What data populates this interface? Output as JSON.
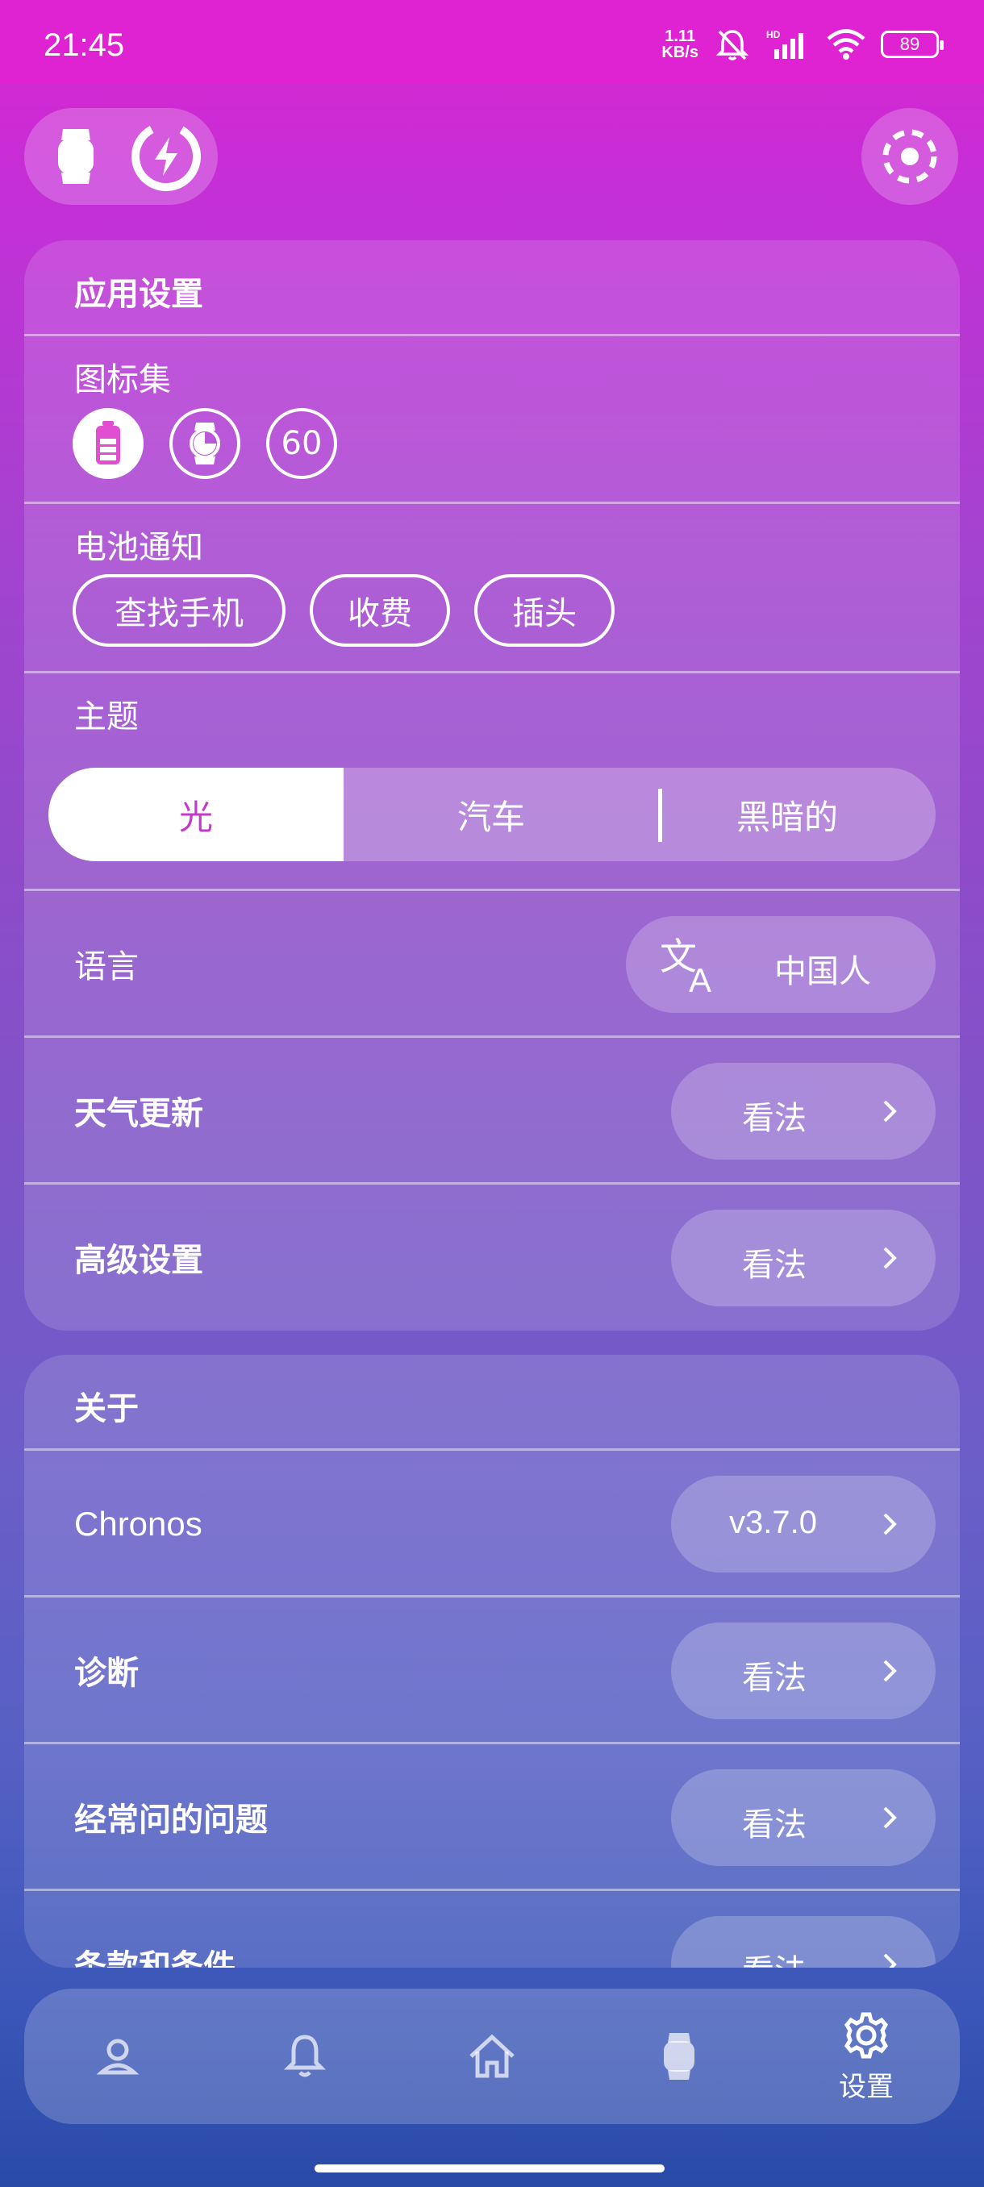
{
  "status_bar": {
    "time": "21:45",
    "net_speed_value": "1.11",
    "net_speed_unit": "KB/s",
    "battery_level": "89"
  },
  "top_bar": {
    "watch_icon": "watch-icon",
    "charge_icon": "charging-icon",
    "loader_icon": "loading-ring-icon"
  },
  "app_settings": {
    "title": "应用设置",
    "icon_set": {
      "label": "图标集",
      "options": [
        {
          "icon": "battery-icon",
          "selected": true
        },
        {
          "icon": "watch-face-icon",
          "selected": false
        },
        {
          "text": "60",
          "selected": false
        }
      ]
    },
    "battery_notifications": {
      "label": "电池通知",
      "chips": [
        "查找手机",
        "收费",
        "插头"
      ]
    },
    "theme": {
      "label": "主题",
      "options": [
        "光",
        "汽车",
        "黑暗的"
      ],
      "selected": "光"
    },
    "language": {
      "label": "语言",
      "value": "中国人",
      "icon": "translate-icon"
    },
    "weather_update": {
      "label": "天气更新",
      "button": "看法"
    },
    "advanced": {
      "label": "高级设置",
      "button": "看法"
    }
  },
  "about": {
    "title": "关于",
    "app_name": "Chronos",
    "version": "v3.7.0",
    "diagnostics": {
      "label": "诊断",
      "button": "看法"
    },
    "faq": {
      "label": "经常问的问题",
      "button": "看法"
    },
    "terms": {
      "label": "条款和条件",
      "button": "看法"
    }
  },
  "bottom_nav": {
    "items": [
      {
        "icon": "profile-icon"
      },
      {
        "icon": "bell-icon"
      },
      {
        "icon": "home-icon"
      },
      {
        "icon": "watch-icon"
      },
      {
        "icon": "gear-icon",
        "label": "设置",
        "active": true
      }
    ]
  },
  "colors": {
    "accent": "#c43ac8",
    "status_bar": "#df23d2"
  }
}
